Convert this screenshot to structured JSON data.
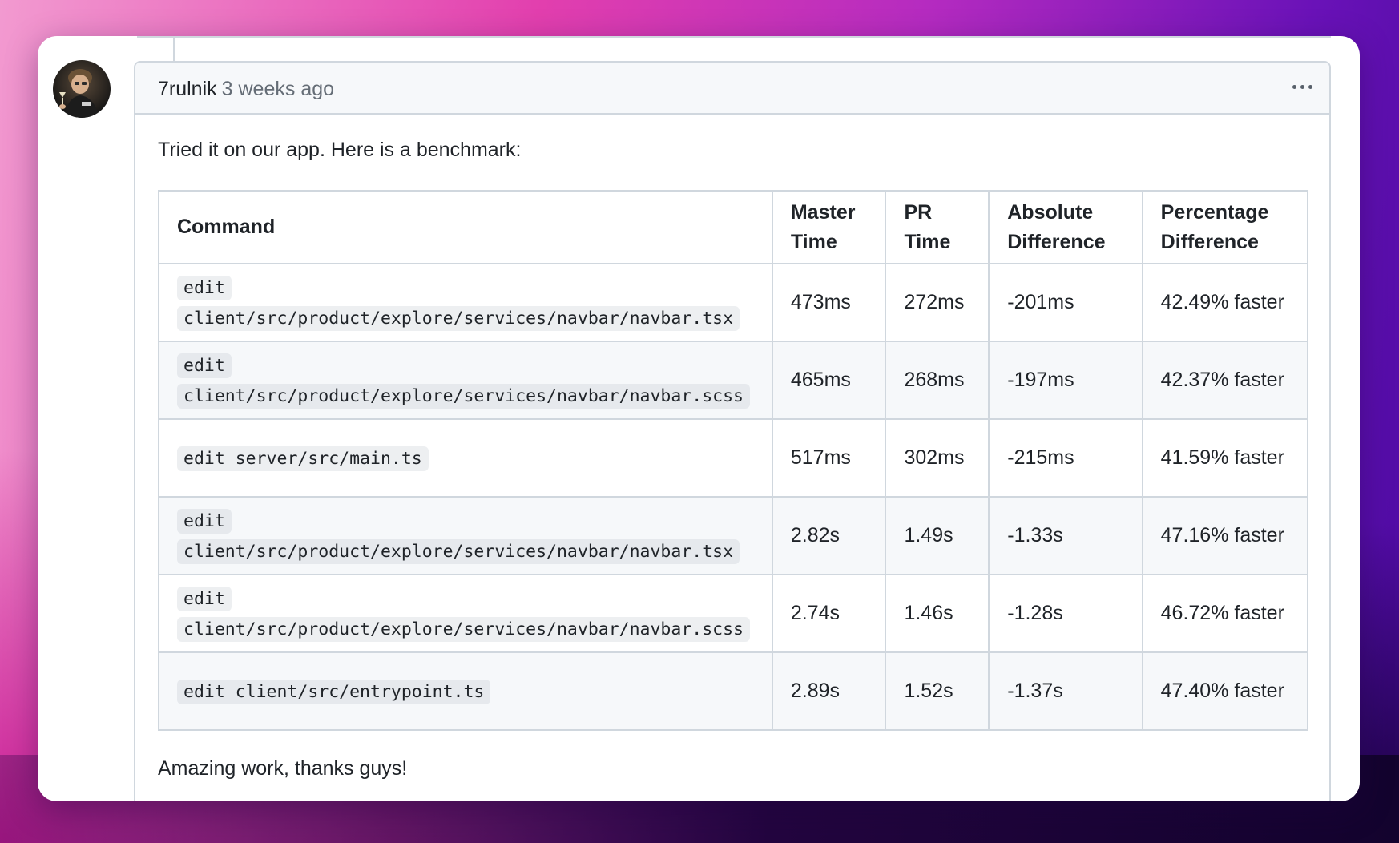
{
  "comment": {
    "author": "7rulnik",
    "time_ago": "3 weeks ago",
    "intro": "Tried it on our app. Here is a benchmark:",
    "outro": "Amazing work, thanks guys!"
  },
  "table": {
    "headers": {
      "command": "Command",
      "master_time": "Master Time",
      "pr_time": "PR Time",
      "absolute_difference": "Absolute Difference",
      "percentage_difference": "Percentage Difference"
    },
    "rows": [
      {
        "command": "edit client/src/product/explore/services/navbar/navbar.tsx",
        "master": "473ms",
        "pr": "272ms",
        "abs": "-201ms",
        "pct": "42.49% faster"
      },
      {
        "command": "edit client/src/product/explore/services/navbar/navbar.scss",
        "master": "465ms",
        "pr": "268ms",
        "abs": "-197ms",
        "pct": "42.37% faster"
      },
      {
        "command": "edit server/src/main.ts",
        "master": "517ms",
        "pr": "302ms",
        "abs": "-215ms",
        "pct": "41.59% faster"
      },
      {
        "command": "edit client/src/product/explore/services/navbar/navbar.tsx",
        "master": "2.82s",
        "pr": "1.49s",
        "abs": "-1.33s",
        "pct": "47.16% faster"
      },
      {
        "command": "edit client/src/product/explore/services/navbar/navbar.scss",
        "master": "2.74s",
        "pr": "1.46s",
        "abs": "-1.28s",
        "pct": "46.72% faster"
      },
      {
        "command": "edit client/src/entrypoint.ts",
        "master": "2.89s",
        "pr": "1.52s",
        "abs": "-1.37s",
        "pct": "47.40% faster"
      }
    ]
  },
  "icons": {
    "more": "kebab-horizontal-icon",
    "avatar": "user-avatar"
  },
  "colors": {
    "border": "#d0d7de",
    "header_bg": "#f6f8fa",
    "muted_text": "#656d76",
    "text": "#1f2328"
  }
}
